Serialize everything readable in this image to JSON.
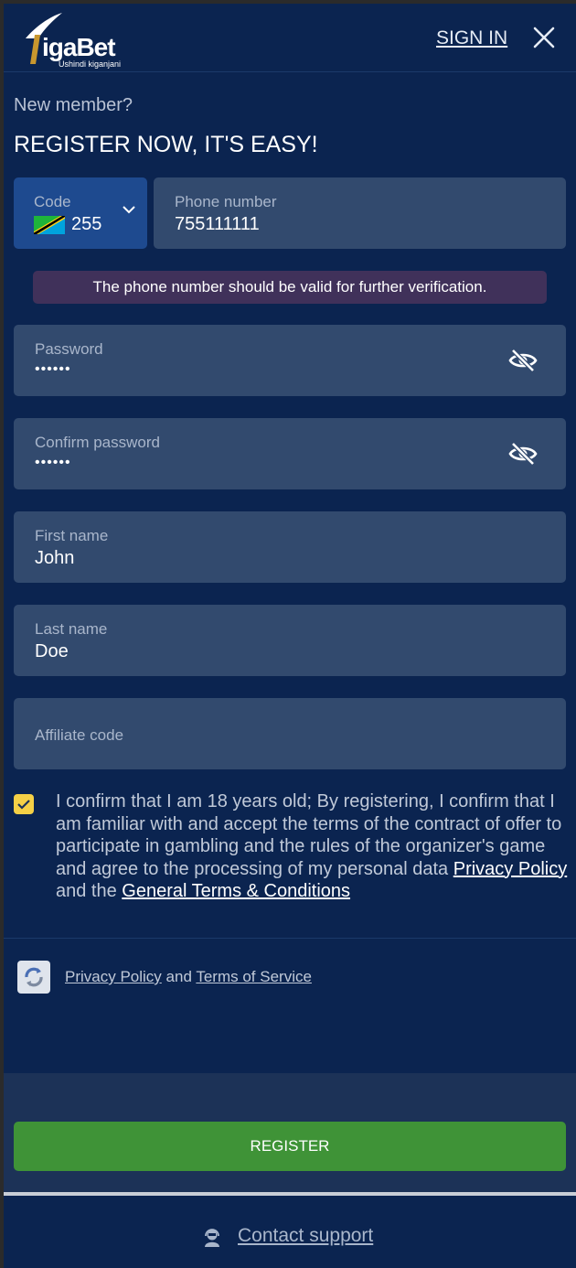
{
  "header": {
    "logo_text": "igaBet",
    "logo_tagline": "Ushindi kiganjani",
    "signin_label": "SIGN IN"
  },
  "intro": {
    "subtitle": "New member?",
    "title": "REGISTER NOW, IT'S EASY!"
  },
  "phone": {
    "code_label": "Code",
    "code_value": "255",
    "number_label": "Phone number",
    "number_value": "755111111",
    "notice": "The phone number should be valid for further verification."
  },
  "password": {
    "label": "Password",
    "value": "••••••"
  },
  "confirm_password": {
    "label": "Confirm password",
    "value": "••••••"
  },
  "first_name": {
    "label": "First name",
    "value": "John"
  },
  "last_name": {
    "label": "Last name",
    "value": "Doe"
  },
  "affiliate": {
    "label": "Affiliate code",
    "value": ""
  },
  "consent": {
    "checked": true,
    "text": "I confirm that I am 18 years old; By registering, I confirm that I am familiar with and accept the terms of the contract of offer to participate in gambling and the rules of the organizer's game and agree to the processing of my personal data",
    "privacy_link": "Privacy Policy",
    "and": "and the",
    "terms_link": "General Terms & Conditions"
  },
  "recaptcha": {
    "privacy_link": "Privacy Policy",
    "and": "and",
    "terms_link": "Terms of Service"
  },
  "register_label": "REGISTER",
  "support_label": "Contact support",
  "colors": {
    "background": "#0b2450",
    "field": "#324a6e",
    "code_field": "#1e4a8f",
    "notice": "#40315a",
    "register": "#3f9337",
    "checkbox": "#f5d046"
  }
}
